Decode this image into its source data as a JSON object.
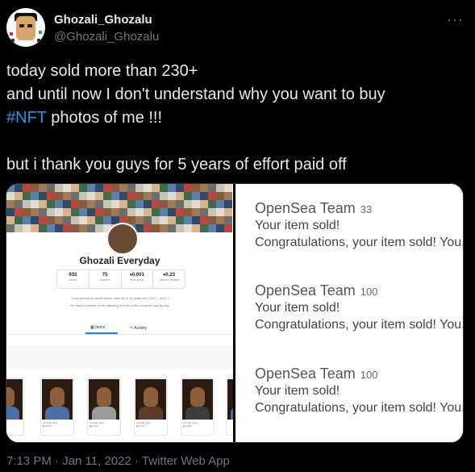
{
  "author": {
    "display_name": "Ghozali_Ghozalu",
    "handle": "@Ghozali_Ghozalu",
    "more_icon": "more-horizontal-icon"
  },
  "tweet": {
    "line1": "today sold more than 230+",
    "line2": "and until now I don't understand why you want to buy",
    "hashtag": "#NFT",
    "line3_rest": " photos of me !!!",
    "line4": "but i thank you guys for 5 years of effort paid off"
  },
  "media_left": {
    "profile_name": "Ghozali Everyday",
    "stats": [
      {
        "value": "933",
        "label": "items"
      },
      {
        "value": "75",
        "label": "owners"
      },
      {
        "value": "♦0.001",
        "label": "floor price"
      },
      {
        "value": "♦0.23",
        "label": "volume traded"
      }
    ],
    "desc1": "I took photos of myself since I was 18 to 22 years old ( 2017 - 2021 )",
    "desc2": "It's really a picture of me standing in front of the computer day by day",
    "tab_items": "Items",
    "tab_activity": "Activity"
  },
  "media_right": {
    "notifications": [
      {
        "team": "OpenSea Team",
        "count": "33",
        "title": "Your item sold!",
        "body": "Congratulations, your item sold! You..."
      },
      {
        "team": "OpenSea Team",
        "count": "100",
        "title": "Your item sold!",
        "body": "Congratulations, your item sold! You..."
      },
      {
        "team": "OpenSea Team",
        "count": "100",
        "title": "Your item sold!",
        "body": "Congratulations, your item sold! You..."
      }
    ]
  },
  "footer": {
    "time": "7:13 PM",
    "sep1": " · ",
    "date": "Jan 11, 2022",
    "sep2": " · ",
    "source": "Twitter Web App"
  },
  "colors": {
    "background": "#000000",
    "text": "#e7e9ea",
    "muted": "#71767b",
    "link": "#1d9bf0"
  }
}
